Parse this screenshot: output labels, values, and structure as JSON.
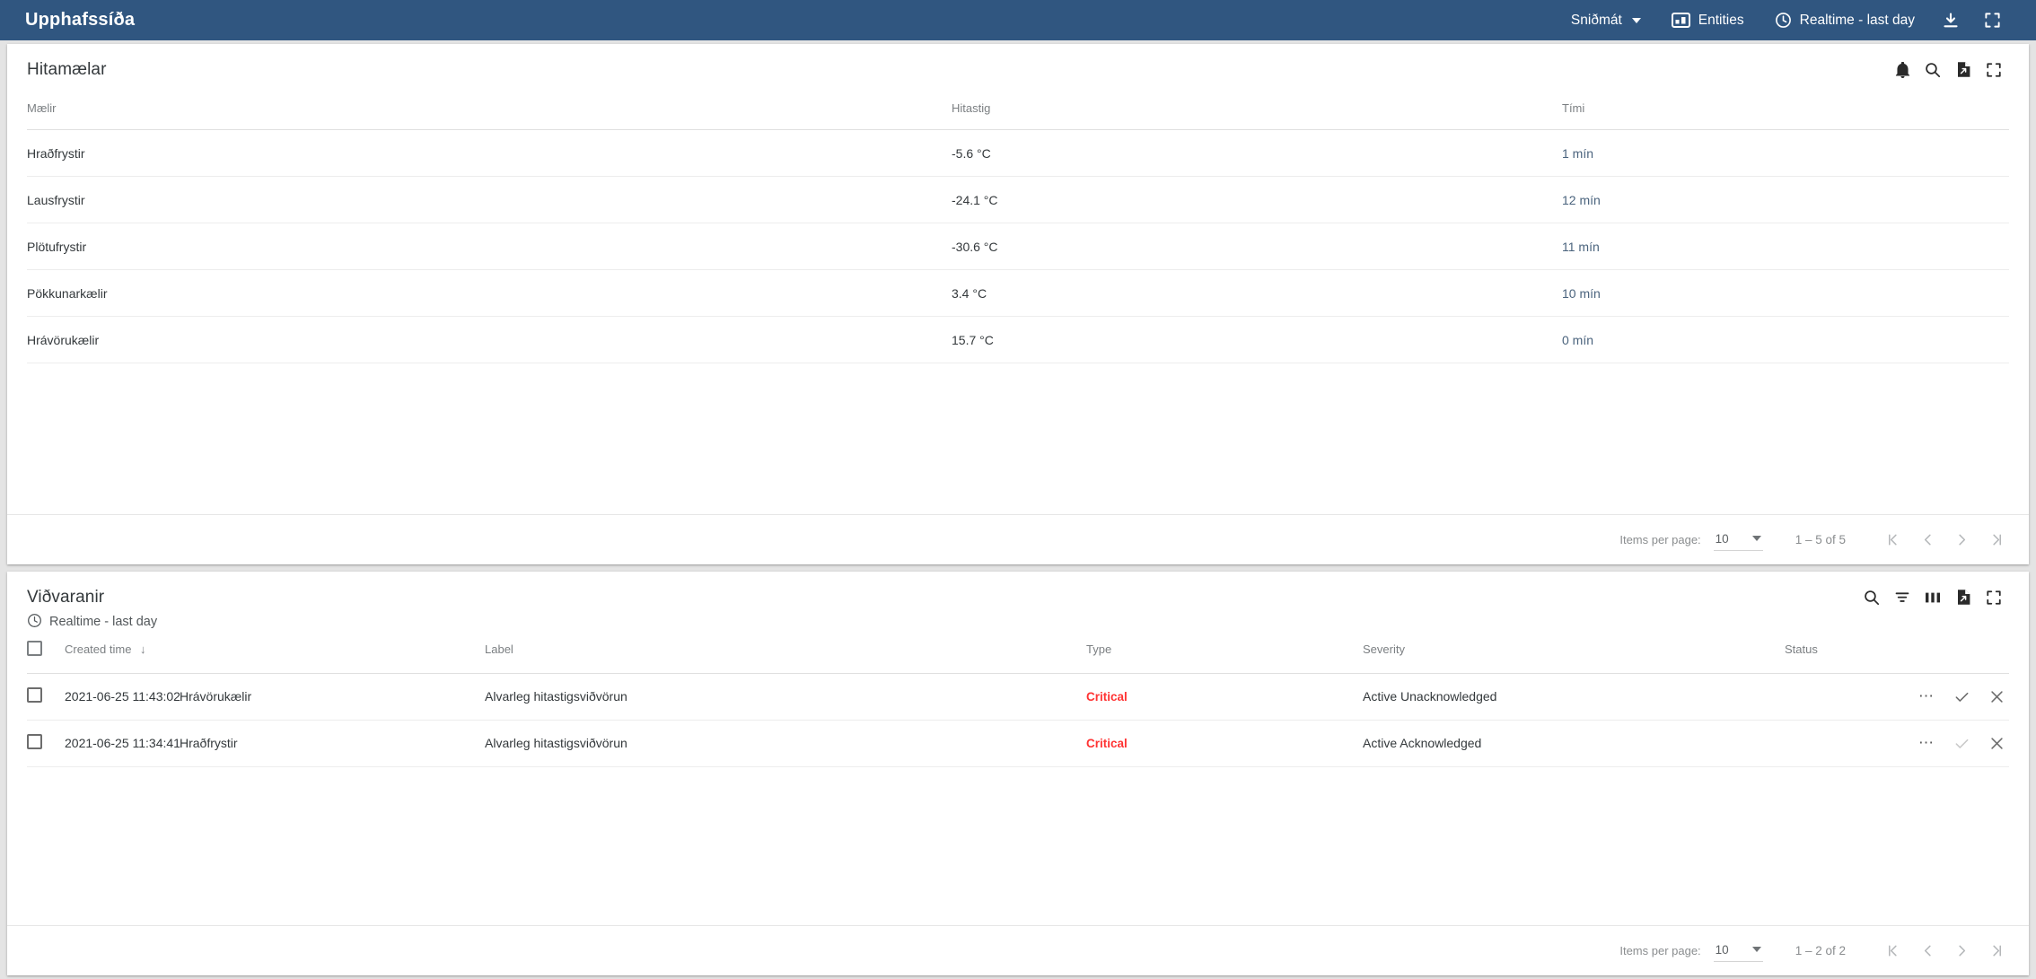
{
  "topbar": {
    "title": "Upphafssíða",
    "actions": [
      {
        "name": "template-menu",
        "label": "Sniðmát",
        "icon": "chevron-down-icon",
        "has_caret": true
      },
      {
        "name": "entities",
        "label": "Entities",
        "icon": "entities-icon",
        "has_caret": false
      },
      {
        "name": "timewindow",
        "label": "Realtime - last day",
        "icon": "clock-icon",
        "has_caret": false
      }
    ],
    "icon_buttons": [
      {
        "name": "download-dashboard",
        "icon": "download-icon"
      },
      {
        "name": "fullscreen-dashboard",
        "icon": "fullscreen-icon"
      }
    ],
    "background": "#305680"
  },
  "thermometers": {
    "title": "Hitamælar",
    "actions": [
      {
        "name": "notifications",
        "icon": "bell-icon"
      },
      {
        "name": "search",
        "icon": "search-icon"
      },
      {
        "name": "export",
        "icon": "export-file-icon"
      },
      {
        "name": "fullscreen",
        "icon": "fullscreen-icon"
      }
    ],
    "columns": [
      "Mælir",
      "Hitastig",
      "Tími"
    ],
    "rows": [
      {
        "name": "Hraðfrystir",
        "temperature": "-5.6 °C",
        "time": "1 mín"
      },
      {
        "name": "Lausfrystir",
        "temperature": "-24.1 °C",
        "time": "12 mín"
      },
      {
        "name": "Plötufrystir",
        "temperature": "-30.6 °C",
        "time": "11 mín"
      },
      {
        "name": "Pökkunarkælir",
        "temperature": "3.4 °C",
        "time": "10 mín"
      },
      {
        "name": "Hrávörukælir",
        "temperature": "15.7 °C",
        "time": "0 mín"
      }
    ],
    "paginator": {
      "items_per_page_label": "Items per page:",
      "items_per_page_value": "10",
      "range": "1 – 5 of 5"
    }
  },
  "alarms": {
    "title": "Viðvaranir",
    "subtitle": "Realtime - last day",
    "subtitle_icon": "clock-icon",
    "actions": [
      {
        "name": "search",
        "icon": "search-icon"
      },
      {
        "name": "filter",
        "icon": "filter-icon"
      },
      {
        "name": "columns",
        "icon": "columns-icon"
      },
      {
        "name": "export",
        "icon": "export-file-icon"
      },
      {
        "name": "fullscreen",
        "icon": "fullscreen-icon"
      }
    ],
    "columns": [
      "Created time",
      "Label",
      "Type",
      "Severity",
      "Status"
    ],
    "sort_column": "Created time",
    "sort_direction": "desc",
    "severity_color": "#ff3333",
    "rows": [
      {
        "created_time": "2021-06-25 11:43:02",
        "label": "Hrávörukælir",
        "type": "Alvarleg hitastigsviðvörun",
        "severity": "Critical",
        "status": "Active Unacknowledged",
        "ack_enabled": true
      },
      {
        "created_time": "2021-06-25 11:34:41",
        "label": "Hraðfrystir",
        "type": "Alvarleg hitastigsviðvörun",
        "severity": "Critical",
        "status": "Active Acknowledged",
        "ack_enabled": false
      }
    ],
    "paginator": {
      "items_per_page_label": "Items per page:",
      "items_per_page_value": "10",
      "range": "1 – 2 of 2"
    }
  }
}
